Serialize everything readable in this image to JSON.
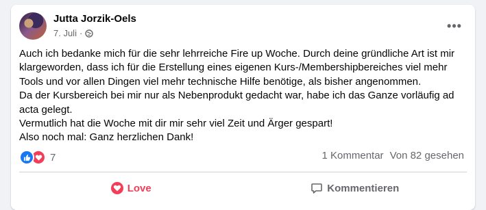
{
  "post": {
    "author": "Jutta Jorzik-Oels",
    "date": "7. Juli",
    "separator": "·",
    "privacy_icon": "globe-icon",
    "more_label": "•••",
    "paragraphs": [
      "Auch ich bedanke mich für die sehr lehrreiche Fire up Woche. Durch deine gründliche Art ist mir klargeworden, dass ich für die Erstellung eines eigenen Kurs-/Membershipbereiches viel mehr Tools und vor allen Dingen viel mehr technische Hilfe benötige, als bisher angenommen.",
      "Da der Kursbereich bei mir nur als Nebenprodukt gedacht war, habe ich das Ganze vorläufig ad acta gelegt.",
      "Vermutlich hat die Woche mit dir mir sehr viel Zeit und Ärger gespart!",
      "Also noch mal: Ganz herzlichen Dank!"
    ]
  },
  "stats": {
    "reaction_icons": [
      "like-icon",
      "love-icon"
    ],
    "reaction_count": "7",
    "comments": "1 Kommentar",
    "views": "Von 82 gesehen"
  },
  "actions": {
    "love_label": "Love",
    "comment_label": "Kommentieren"
  },
  "colors": {
    "love_red": "#f33e58",
    "like_blue": "#1877f2",
    "secondary_text": "#65676b"
  }
}
